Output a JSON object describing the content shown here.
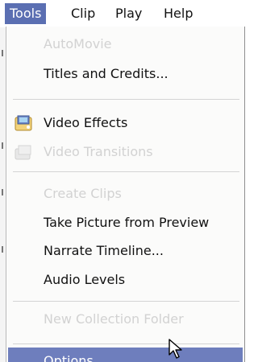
{
  "menubar": {
    "items": [
      {
        "label": "Tools"
      },
      {
        "label": "Clip"
      },
      {
        "label": "Play"
      },
      {
        "label": "Help"
      }
    ]
  },
  "menu": {
    "items": [
      {
        "label": "AutoMovie",
        "enabled": false
      },
      {
        "label": "Titles and Credits...",
        "enabled": true
      },
      {
        "label": "Video Effects",
        "enabled": true,
        "icon": "video-effects-icon"
      },
      {
        "label": "Video Transitions",
        "enabled": false,
        "icon": "video-transitions-icon"
      },
      {
        "label": "Create Clips",
        "enabled": false
      },
      {
        "label": "Take Picture from Preview",
        "enabled": true
      },
      {
        "label": "Narrate Timeline...",
        "enabled": true
      },
      {
        "label": "Audio Levels",
        "enabled": true
      },
      {
        "label": "New Collection Folder",
        "enabled": false
      },
      {
        "label": "Options...",
        "enabled": true,
        "highlighted": true
      }
    ]
  },
  "colors": {
    "menubar_active": "#5b6fb2",
    "highlight": "#6e7ebd",
    "disabled_text": "#d2d2d2"
  }
}
